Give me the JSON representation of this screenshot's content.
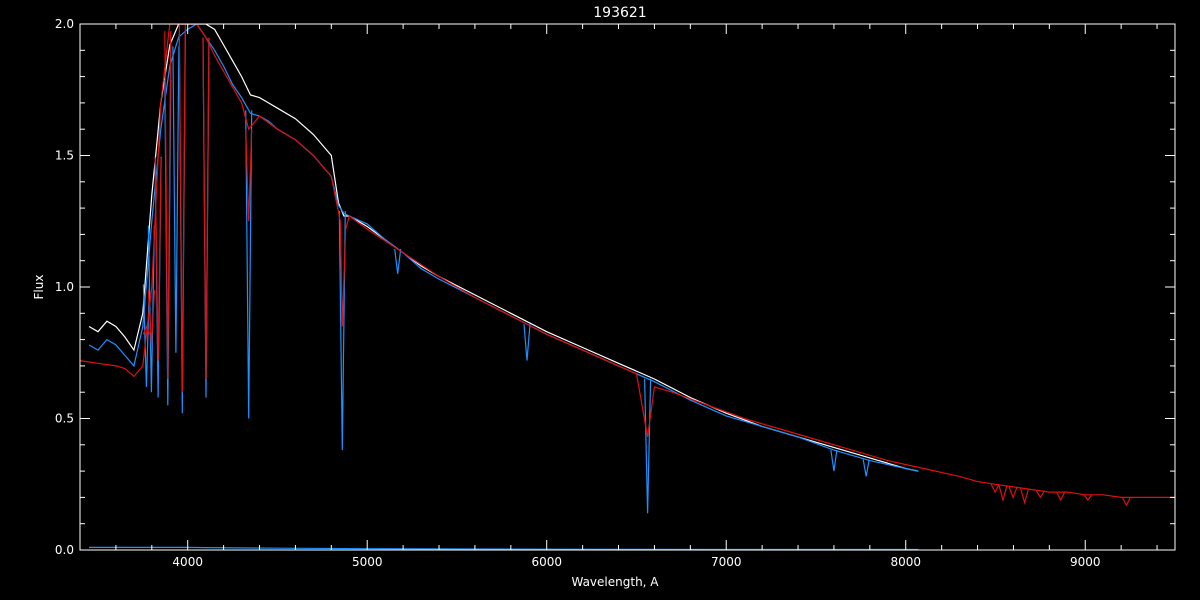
{
  "chart_data": {
    "type": "line",
    "title": "193621",
    "xlabel": "Wavelength, A",
    "ylabel": "Flux",
    "xlim": [
      3400,
      9500
    ],
    "ylim": [
      0.0,
      2.0
    ],
    "xticks": [
      4000,
      5000,
      6000,
      7000,
      8000,
      9000
    ],
    "xtick_labels": [
      "4000",
      "5000",
      "6000",
      "7000",
      "8000",
      "9000"
    ],
    "yticks": [
      0.0,
      0.5,
      1.0,
      1.5,
      2.0
    ],
    "ytick_labels": [
      "0.0",
      "0.5",
      "1.0",
      "1.5",
      "2.0"
    ],
    "colors": {
      "background": "#000000",
      "axes": "#ffffff",
      "observed_white": "#ffffff",
      "observed_blue": "#1e90ff",
      "model_red": "#e01010",
      "error_blue": "#1e90ff"
    },
    "series": [
      {
        "key": "white",
        "color": "#ffffff",
        "x": [
          3450,
          3500,
          3550,
          3600,
          3650,
          3700,
          3750,
          3800,
          3850,
          3900,
          3950,
          4000,
          4050,
          4100,
          4150,
          4200,
          4250,
          4300,
          4350,
          4400,
          4450,
          4500,
          4600,
          4700,
          4800,
          4840,
          4870,
          4900,
          5000,
          5100,
          5200,
          5300,
          5400,
          5600,
          5800,
          6000,
          6200,
          6400,
          6600,
          6800,
          7000,
          7200,
          7400,
          7600,
          7800,
          8000,
          8070
        ],
        "y": [
          0.85,
          0.83,
          0.87,
          0.85,
          0.81,
          0.76,
          0.9,
          1.35,
          1.7,
          1.92,
          2.0,
          2.05,
          2.05,
          2.02,
          1.98,
          1.92,
          1.86,
          1.8,
          1.73,
          1.72,
          1.7,
          1.68,
          1.64,
          1.58,
          1.5,
          1.32,
          1.27,
          1.27,
          1.23,
          1.18,
          1.13,
          1.08,
          1.04,
          0.97,
          0.9,
          0.83,
          0.77,
          0.71,
          0.65,
          0.58,
          0.52,
          0.47,
          0.43,
          0.39,
          0.35,
          0.31,
          0.3
        ]
      },
      {
        "key": "blue",
        "color": "#1e90ff",
        "x": [
          3450,
          3500,
          3550,
          3600,
          3650,
          3700,
          3750,
          3800,
          3850,
          3900,
          3950,
          4000,
          4050,
          4100,
          4150,
          4200,
          4250,
          4300,
          4350,
          4400,
          4450,
          4500,
          4600,
          4700,
          4800,
          4840,
          4870,
          4900,
          5000,
          5100,
          5200,
          5300,
          5400,
          5600,
          5800,
          6000,
          6200,
          6400,
          6600,
          6800,
          7000,
          7200,
          7400,
          7600,
          7800,
          8000,
          8070
        ],
        "y": [
          0.78,
          0.76,
          0.8,
          0.78,
          0.74,
          0.7,
          0.85,
          1.25,
          1.6,
          1.84,
          1.95,
          1.98,
          2.0,
          1.95,
          1.9,
          1.84,
          1.77,
          1.72,
          1.66,
          1.65,
          1.63,
          1.6,
          1.56,
          1.5,
          1.42,
          1.31,
          1.28,
          1.27,
          1.24,
          1.18,
          1.13,
          1.07,
          1.03,
          0.96,
          0.89,
          0.82,
          0.76,
          0.7,
          0.64,
          0.57,
          0.51,
          0.47,
          0.43,
          0.38,
          0.34,
          0.31,
          0.3
        ]
      },
      {
        "key": "red",
        "color": "#e01010",
        "x": [
          3400,
          3500,
          3600,
          3650,
          3700,
          3750,
          3800,
          3850,
          3900,
          3950,
          4000,
          4050,
          4100,
          4150,
          4200,
          4250,
          4300,
          4340,
          4400,
          4500,
          4600,
          4700,
          4800,
          4850,
          4861,
          4880,
          4900,
          5000,
          5200,
          5400,
          5600,
          5800,
          6000,
          6200,
          6400,
          6500,
          6562,
          6600,
          6700,
          6900,
          7100,
          7300,
          7500,
          7700,
          7900,
          8100,
          8300,
          8400,
          8500,
          8600,
          8700,
          8800,
          8900,
          9000,
          9100,
          9200,
          9300,
          9400,
          9500
        ],
        "y": [
          0.72,
          0.71,
          0.7,
          0.69,
          0.66,
          0.7,
          1.0,
          1.7,
          2.05,
          2.05,
          2.05,
          2.05,
          1.95,
          1.88,
          1.82,
          1.76,
          1.7,
          1.6,
          1.65,
          1.6,
          1.56,
          1.5,
          1.42,
          1.25,
          0.85,
          1.22,
          1.27,
          1.22,
          1.13,
          1.04,
          0.96,
          0.89,
          0.82,
          0.76,
          0.7,
          0.67,
          0.43,
          0.62,
          0.6,
          0.55,
          0.5,
          0.46,
          0.42,
          0.38,
          0.34,
          0.31,
          0.28,
          0.26,
          0.25,
          0.24,
          0.23,
          0.22,
          0.22,
          0.21,
          0.21,
          0.2,
          0.2,
          0.2,
          0.2
        ]
      },
      {
        "key": "error",
        "color": "#1e90ff",
        "x": [
          3450,
          3700,
          3900,
          4000,
          4100,
          4500,
          5000,
          6000,
          7000,
          8070
        ],
        "y": [
          0.01,
          0.01,
          0.01,
          0.01,
          0.009,
          0.007,
          0.005,
          0.003,
          0.002,
          0.002
        ]
      }
    ],
    "absorption_lines": [
      {
        "series": "blue",
        "x": 3770,
        "y": 0.62
      },
      {
        "series": "blue",
        "x": 3798,
        "y": 0.6
      },
      {
        "series": "blue",
        "x": 3835,
        "y": 0.58
      },
      {
        "series": "blue",
        "x": 3889,
        "y": 0.55
      },
      {
        "series": "blue",
        "x": 3934,
        "y": 0.75
      },
      {
        "series": "blue",
        "x": 3970,
        "y": 0.52
      },
      {
        "series": "blue",
        "x": 4102,
        "y": 0.58
      },
      {
        "series": "blue",
        "x": 4340,
        "y": 0.5
      },
      {
        "series": "blue",
        "x": 4861,
        "y": 0.38
      },
      {
        "series": "blue",
        "x": 5170,
        "y": 1.05
      },
      {
        "series": "blue",
        "x": 5890,
        "y": 0.72
      },
      {
        "series": "blue",
        "x": 6562,
        "y": 0.14
      },
      {
        "series": "blue",
        "x": 7600,
        "y": 0.3
      },
      {
        "series": "blue",
        "x": 7780,
        "y": 0.28
      },
      {
        "series": "red",
        "x": 3770,
        "y": 0.85
      },
      {
        "series": "red",
        "x": 3798,
        "y": 0.78
      },
      {
        "series": "red",
        "x": 3835,
        "y": 0.72
      },
      {
        "series": "red",
        "x": 3889,
        "y": 0.65
      },
      {
        "series": "red",
        "x": 3970,
        "y": 0.6
      },
      {
        "series": "red",
        "x": 4102,
        "y": 0.65
      },
      {
        "series": "red",
        "x": 4340,
        "y": 1.25
      },
      {
        "series": "red",
        "x": 8498,
        "y": 0.22
      },
      {
        "series": "red",
        "x": 8542,
        "y": 0.19
      },
      {
        "series": "red",
        "x": 8598,
        "y": 0.2
      },
      {
        "series": "red",
        "x": 8662,
        "y": 0.18
      },
      {
        "series": "red",
        "x": 8750,
        "y": 0.2
      },
      {
        "series": "red",
        "x": 8863,
        "y": 0.19
      },
      {
        "series": "red",
        "x": 9015,
        "y": 0.19
      },
      {
        "series": "red",
        "x": 9229,
        "y": 0.17
      }
    ],
    "grid": false,
    "legend": "none"
  }
}
